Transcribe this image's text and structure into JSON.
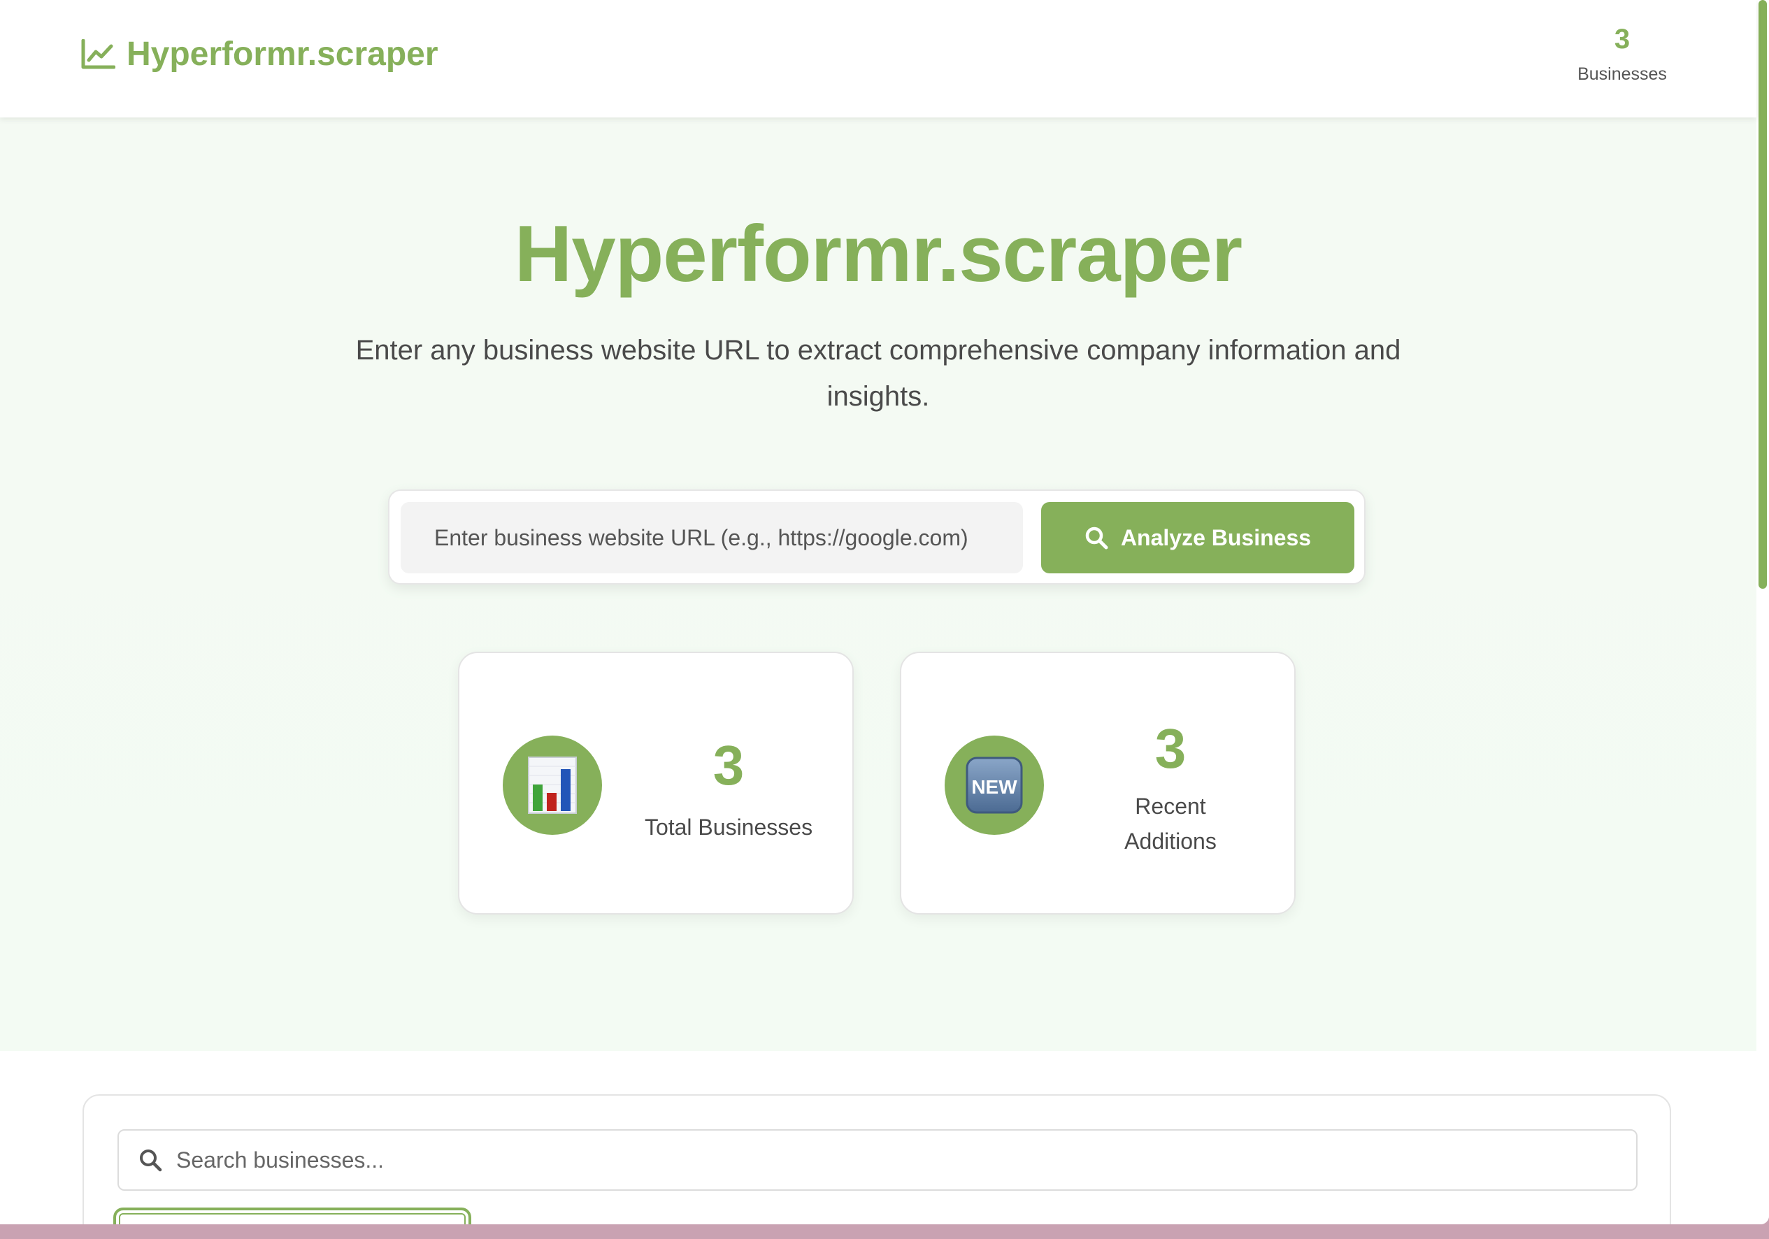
{
  "header": {
    "brand": "Hyperformr.scraper",
    "stat_value": "3",
    "stat_label": "Businesses"
  },
  "hero": {
    "title": "Hyperformr.scraper",
    "subtitle": "Enter any business website URL to extract comprehensive company information and insights.",
    "url_placeholder": "Enter business website URL (e.g., https://google.com)",
    "analyze_label": "Analyze Business"
  },
  "stats": [
    {
      "icon": "bar-chart-icon",
      "value": "3",
      "label": "Total Businesses"
    },
    {
      "icon": "new-badge-icon",
      "icon_text": "NEW",
      "value": "3",
      "label": "Recent Additions"
    }
  ],
  "list": {
    "search_placeholder": "Search businesses..."
  },
  "colors": {
    "accent": "#86b05a",
    "hero_bg": "#f4faf3",
    "text": "#4a4a4a"
  }
}
